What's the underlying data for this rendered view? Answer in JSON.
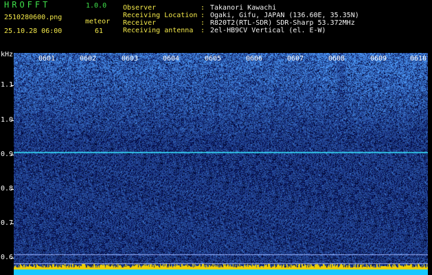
{
  "app": {
    "title": "HROFFT",
    "version": "1.0.0",
    "file_name": "2510280600.png",
    "timestamp": "25.10.28 06:00",
    "meteor_label": "meteor",
    "meteor_count": "61"
  },
  "info": [
    {
      "label": "Observer",
      "value": "Takanori Kawachi"
    },
    {
      "label": "Receiving Location",
      "value": "Ogaki, Gifu, JAPAN (136.60E, 35.35N)"
    },
    {
      "label": "Receiver",
      "value": "R820T2(RTL-SDR) SDR-Sharp 53.372MHz"
    },
    {
      "label": "Receiving antenna",
      "value": "2el-HB9CV Vertical (el. E-W)"
    }
  ],
  "colon": ":",
  "spectrogram": {
    "y_unit": "kHz",
    "y_ticks": [
      "1.1",
      "1.0",
      "0.9",
      "0.8",
      "0.7",
      "0.6"
    ],
    "x_ticks": [
      "0601",
      "0602",
      "0603",
      "0604",
      "0605",
      "0606",
      "0607",
      "0608",
      "0609",
      "0610"
    ],
    "colors": {
      "background": "#000000",
      "noise_low": "#0a1a8c",
      "noise_high": "#3d7dff",
      "carrier": "#36e3ff",
      "bottom_band": "#f0d000"
    }
  }
}
